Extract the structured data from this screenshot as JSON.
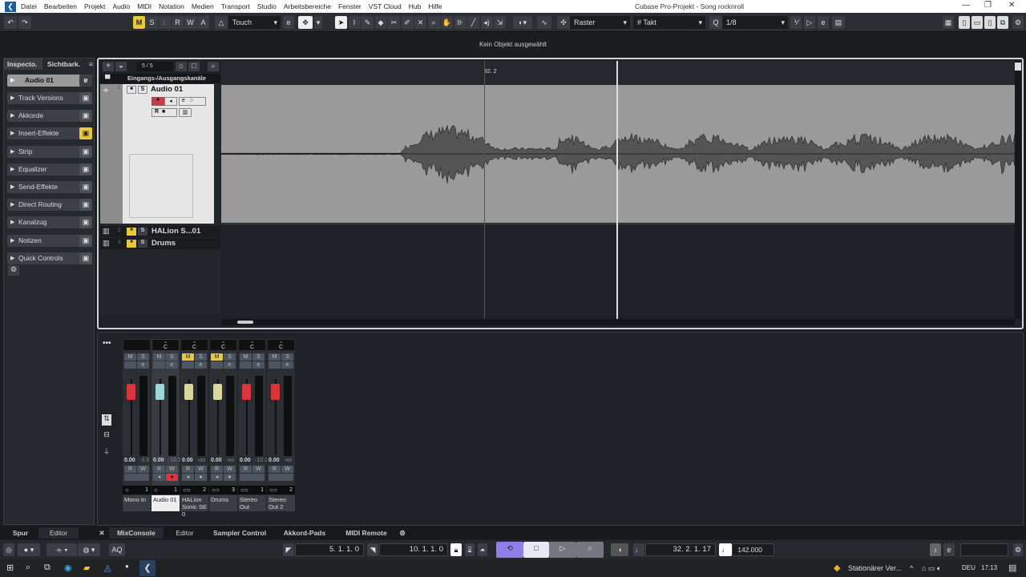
{
  "menu": [
    "Datei",
    "Bearbeiten",
    "Projekt",
    "Audio",
    "MIDI",
    "Notation",
    "Medien",
    "Transport",
    "Studio",
    "Arbeitsbereiche",
    "Fenster",
    "VST Cloud",
    "Hub",
    "Hilfe"
  ],
  "window_title": "Cubase Pro-Projekt - Song rocknroll",
  "toolbar": {
    "msrwa": [
      "M",
      "S",
      "L",
      "R",
      "W",
      "A"
    ],
    "automation_mode": "Touch",
    "snap_type": "Raster",
    "grid": "Takt",
    "quantize": "1/8"
  },
  "info_line": "Kein Objekt ausgewählt",
  "inspector": {
    "tabs": [
      "Inspecto.",
      "Sichtbark."
    ],
    "track_name": "Audio 01",
    "sections": [
      {
        "label": "Track Versions",
        "icon": "versions-icon"
      },
      {
        "label": "Akkorde",
        "icon": "chords-icon"
      },
      {
        "label": "Insert-Effekte",
        "icon": "insert-icon"
      },
      {
        "label": "Strip",
        "icon": "strip-icon"
      },
      {
        "label": "Equalizer",
        "icon": "eq-icon"
      },
      {
        "label": "Send-Effekte",
        "icon": "send-icon"
      },
      {
        "label": "Direct Routing",
        "icon": "routing-icon"
      },
      {
        "label": "Kanalzug",
        "icon": "channelstrip-icon"
      },
      {
        "label": "Notizen",
        "icon": "notes-icon"
      },
      {
        "label": "Quick Controls",
        "icon": "quick-controls-icon"
      }
    ]
  },
  "project": {
    "track_count": "5 / 5",
    "folder": "Eingangs-/Ausgangskanäle",
    "ruler_marker": "32. 2",
    "tracks": [
      {
        "num": "1",
        "name": "Audio 01"
      },
      {
        "num": "2",
        "name": "HALion S...01"
      },
      {
        "num": "3",
        "name": "Drums"
      }
    ]
  },
  "mixer": {
    "channels": [
      {
        "name": "Mono In",
        "num": "1",
        "vol": "0.00",
        "peak": "-3.9",
        "color": "#d9353a",
        "mute": false
      },
      {
        "name": "Audio 01",
        "num": "1",
        "vol": "0.00",
        "peak": "-10.3",
        "color": "#9fd6d8",
        "mute": false
      },
      {
        "name": "HALion Sonic SE 0",
        "num": "2",
        "vol": "0.00",
        "peak": "-oo",
        "color": "#d9d6a0",
        "mute": true
      },
      {
        "name": "Drums",
        "num": "3",
        "vol": "0.00",
        "peak": "-oo",
        "color": "#d9d6a0",
        "mute": true
      },
      {
        "name": "Stereo Out",
        "num": "1",
        "vol": "0.00",
        "peak": "-10.3",
        "color": "#d9353a",
        "mute": false
      },
      {
        "name": "Stereo Out 2",
        "num": "2",
        "vol": "0.00",
        "peak": "-oo",
        "color": "#d9353a",
        "mute": false
      }
    ]
  },
  "bottom_tabs": {
    "left": [
      "Spur",
      "Editor"
    ],
    "right": [
      "MixConsole",
      "Editor",
      "Sampler Control",
      "Akkord-Pads",
      "MIDI Remote"
    ]
  },
  "transport": {
    "aq": "AQ",
    "left_locator": "5. 1. 1.  0",
    "right_locator": "10. 1. 1.  0",
    "position": "32. 2. 1. 17",
    "tempo": "142.000"
  },
  "taskbar": {
    "notification": "Stationärer Ver...",
    "lang": "DEU",
    "time": "17:13"
  }
}
